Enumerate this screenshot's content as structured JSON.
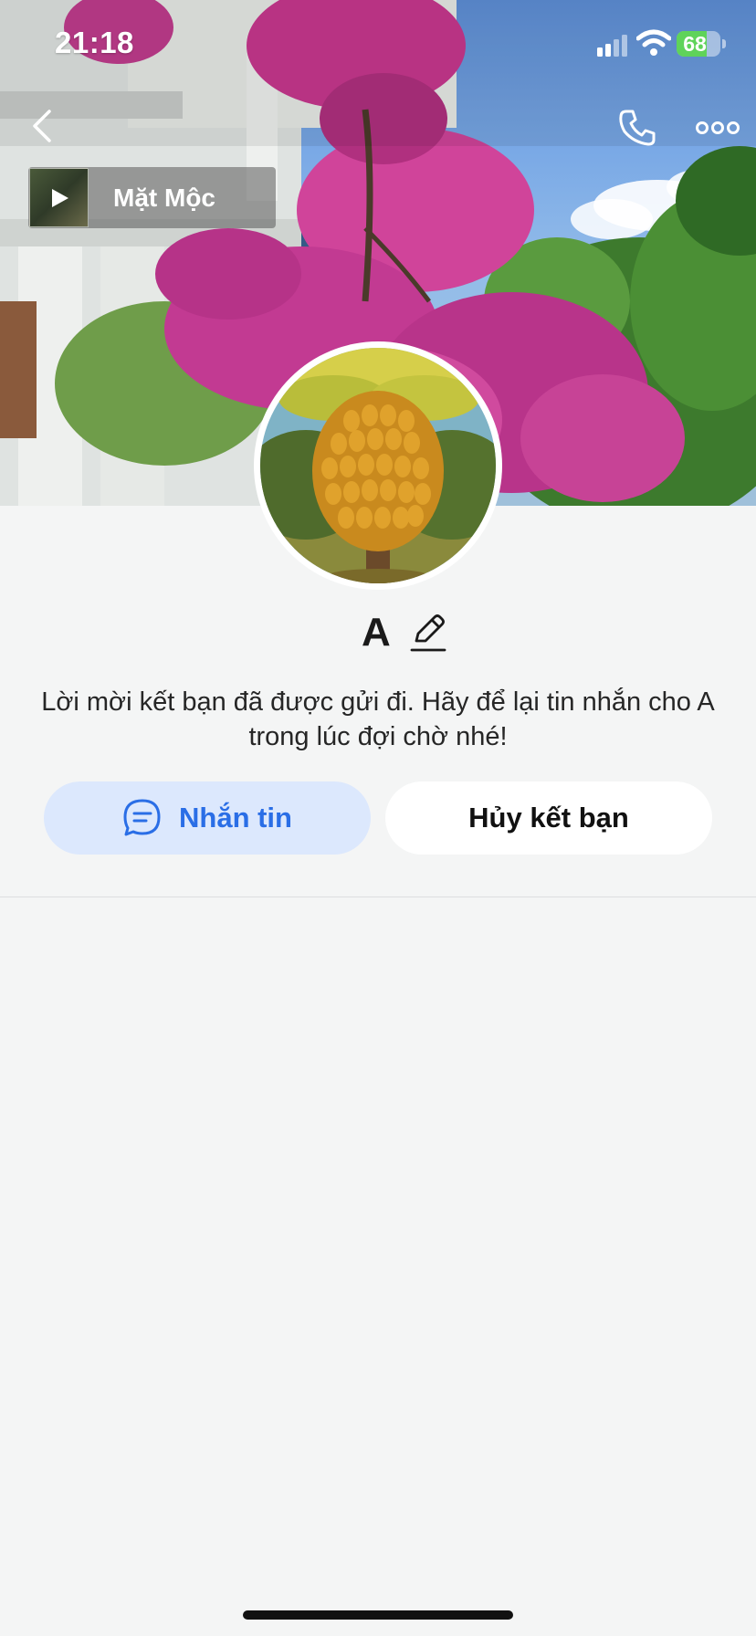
{
  "status_bar": {
    "time": "21:18",
    "battery_percent": "68",
    "battery_level": 0.68,
    "icons": [
      "signal-icon",
      "wifi-icon",
      "battery-icon"
    ]
  },
  "nav": {
    "icons": [
      "back-arrow-icon",
      "phone-call-icon",
      "more-options-icon"
    ]
  },
  "music": {
    "title": "Mặt Mộc",
    "icon": "play-icon"
  },
  "profile": {
    "name": "A",
    "edit_icon": "pencil-icon",
    "status_message": "Lời mời kết bạn đã được gửi đi. Hãy để lại tin nhắn cho A trong lúc đợi chờ nhé!"
  },
  "actions": {
    "message_label": "Nhắn tin",
    "message_icon": "chat-bubble-icon",
    "unfriend_label": "Hủy kết bạn"
  },
  "colors": {
    "accent_blue": "#2a6ee6",
    "message_button_bg": "#dce8fd",
    "page_bg": "#f4f5f5",
    "battery_green": "#5fd35a"
  }
}
